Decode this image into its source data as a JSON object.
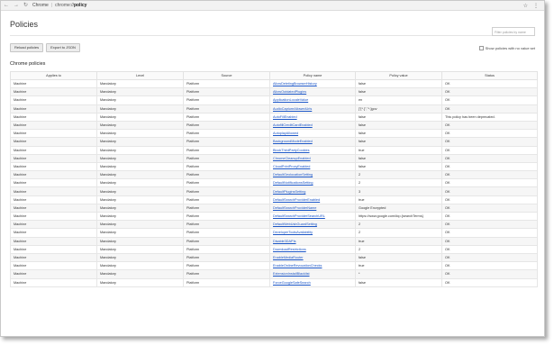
{
  "browser": {
    "brand": "Chrome",
    "url_prefix": "chrome://",
    "url_bold": "policy",
    "nav_back": "←",
    "nav_forward": "→",
    "nav_reload": "↻",
    "bookmark_star": "☆",
    "menu_dots": "⋮"
  },
  "header": {
    "title": "Policies",
    "filter_placeholder": "Filter policies by name"
  },
  "actions": {
    "reload_label": "Reload policies",
    "export_label": "Export to JSON",
    "show_unset_label": "Show policies with no value set"
  },
  "section_title": "Chrome policies",
  "table": {
    "columns": [
      "Applies to",
      "Level",
      "Source",
      "Policy name",
      "Policy value",
      "Status"
    ],
    "rows": [
      [
        "Machine",
        "Mandatory",
        "Platform",
        "AllowDeletingBrowserHistory",
        "false",
        "OK"
      ],
      [
        "Machine",
        "Mandatory",
        "Platform",
        "AllowOutdatedPlugins",
        "false",
        "OK"
      ],
      [
        "Machine",
        "Mandatory",
        "Platform",
        "ApplicationLocaleValue",
        "en",
        "OK"
      ],
      [
        "Machine",
        "Mandatory",
        "Platform",
        "AudioCaptureAllowedUrls",
        "[\"[*.]\",\"*.]gov",
        "OK"
      ],
      [
        "Machine",
        "Mandatory",
        "Platform",
        "AutoFillEnabled",
        "false",
        "This policy has been deprecated."
      ],
      [
        "Machine",
        "Mandatory",
        "Platform",
        "AutofillCreditCardEnabled",
        "false",
        "OK"
      ],
      [
        "Machine",
        "Mandatory",
        "Platform",
        "AutoplayAllowed",
        "false",
        "OK"
      ],
      [
        "Machine",
        "Mandatory",
        "Platform",
        "BackgroundModeEnabled",
        "false",
        "OK"
      ],
      [
        "Machine",
        "Mandatory",
        "Platform",
        "BlockThirdPartyCookies",
        "true",
        "OK"
      ],
      [
        "Machine",
        "Mandatory",
        "Platform",
        "ChromeCleanupEnabled",
        "false",
        "OK"
      ],
      [
        "Machine",
        "Mandatory",
        "Platform",
        "CloudPrintProxyEnabled",
        "false",
        "OK"
      ],
      [
        "Machine",
        "Mandatory",
        "Platform",
        "DefaultGeolocationSetting",
        "2",
        "OK"
      ],
      [
        "Machine",
        "Mandatory",
        "Platform",
        "DefaultNotificationsSetting",
        "2",
        "OK"
      ],
      [
        "Machine",
        "Mandatory",
        "Platform",
        "DefaultPluginsSetting",
        "3",
        "OK"
      ],
      [
        "Machine",
        "Mandatory",
        "Platform",
        "DefaultSearchProviderEnabled",
        "true",
        "OK"
      ],
      [
        "Machine",
        "Mandatory",
        "Platform",
        "DefaultSearchProviderName",
        "Google Encrypted",
        "OK"
      ],
      [
        "Machine",
        "Mandatory",
        "Platform",
        "DefaultSearchProviderSearchURL",
        "https://www.google.com/#q={searchTerms}",
        "OK"
      ],
      [
        "Machine",
        "Mandatory",
        "Platform",
        "DefaultWebUsbGuardSetting",
        "2",
        "OK"
      ],
      [
        "Machine",
        "Mandatory",
        "Platform",
        "DeveloperToolsAvailability",
        "2",
        "OK"
      ],
      [
        "Machine",
        "Mandatory",
        "Platform",
        "Disable3DAPIs",
        "true",
        "OK"
      ],
      [
        "Machine",
        "Mandatory",
        "Platform",
        "DownloadRestrictions",
        "2",
        "OK"
      ],
      [
        "Machine",
        "Mandatory",
        "Platform",
        "EnableMediaRouter",
        "false",
        "OK"
      ],
      [
        "Machine",
        "Mandatory",
        "Platform",
        "EnableOnlineRevocationChecks",
        "true",
        "OK"
      ],
      [
        "Machine",
        "Mandatory",
        "Platform",
        "ExtensionInstallBlacklist",
        "*",
        "OK"
      ],
      [
        "Machine",
        "Mandatory",
        "Platform",
        "ForceGoogleSafeSearch",
        "false",
        "OK"
      ]
    ]
  }
}
